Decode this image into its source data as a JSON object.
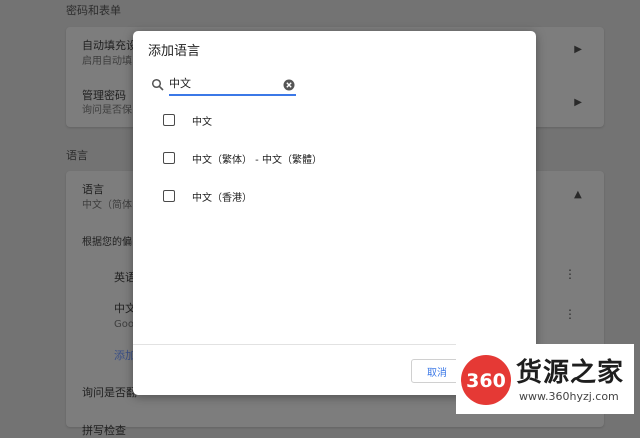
{
  "settings": {
    "passwords_section": "密码和表单",
    "autofill": {
      "title": "自动填充设",
      "subtitle": "启用自动填"
    },
    "manage_passwords": {
      "title": "管理密码",
      "subtitle": "询问是否保"
    },
    "languages_section": "语言",
    "language": {
      "title": "语言",
      "subtitle": "中文（简体"
    },
    "order_hint": "根据您的偏",
    "english_item": "英语",
    "chinese_item": {
      "title": "中文",
      "subtitle": "Goo"
    },
    "add_language_link": "添加",
    "translate_prompt": "询问是否翻",
    "spellcheck": "拼写检查"
  },
  "dialog": {
    "title": "添加语言",
    "search": {
      "value": "中文",
      "placeholder": ""
    },
    "options": [
      {
        "label": "中文",
        "checked": false
      },
      {
        "label": "中文（繁体） - 中文（繁體）",
        "checked": false
      },
      {
        "label": "中文（香港）",
        "checked": false
      }
    ],
    "cancel_label": "取消",
    "accent_color": "#3b78e7"
  },
  "watermark": {
    "logo_text": "360",
    "title": "货源之家",
    "url": "www.360hyzj.com"
  }
}
